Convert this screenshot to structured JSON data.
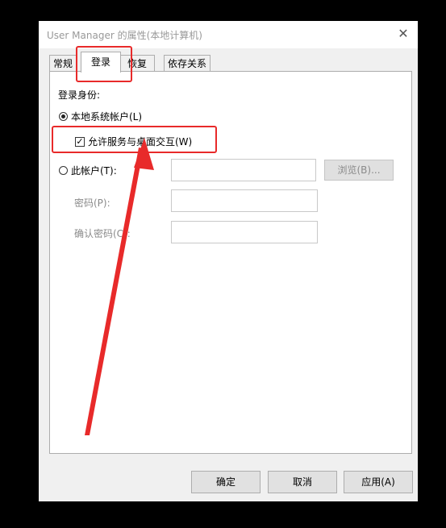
{
  "window": {
    "title": "User Manager 的属性(本地计算机)",
    "close_glyph": "✕"
  },
  "tabs": [
    {
      "label": "常规",
      "active": false
    },
    {
      "label": "登录",
      "active": true
    },
    {
      "label": "恢复",
      "active": false
    },
    {
      "label": "依存关系",
      "active": false
    }
  ],
  "logon": {
    "section_label": "登录身份:",
    "local_system_label": "本地系统帐户(L)",
    "local_system_selected": true,
    "desktop_interact_label": "允许服务与桌面交互(W)",
    "desktop_interact_checked": true,
    "check_glyph": "✓",
    "this_account_label": "此帐户(T):",
    "this_account_selected": false,
    "account_value": "",
    "browse_label": "浏览(B)...",
    "password_label": "密码(P):",
    "password_value": "",
    "confirm_label": "确认密码(C):",
    "confirm_value": ""
  },
  "buttons": {
    "ok": "确定",
    "cancel": "取消",
    "apply": "应用(A)"
  },
  "annotation_color": "#e82a2a"
}
